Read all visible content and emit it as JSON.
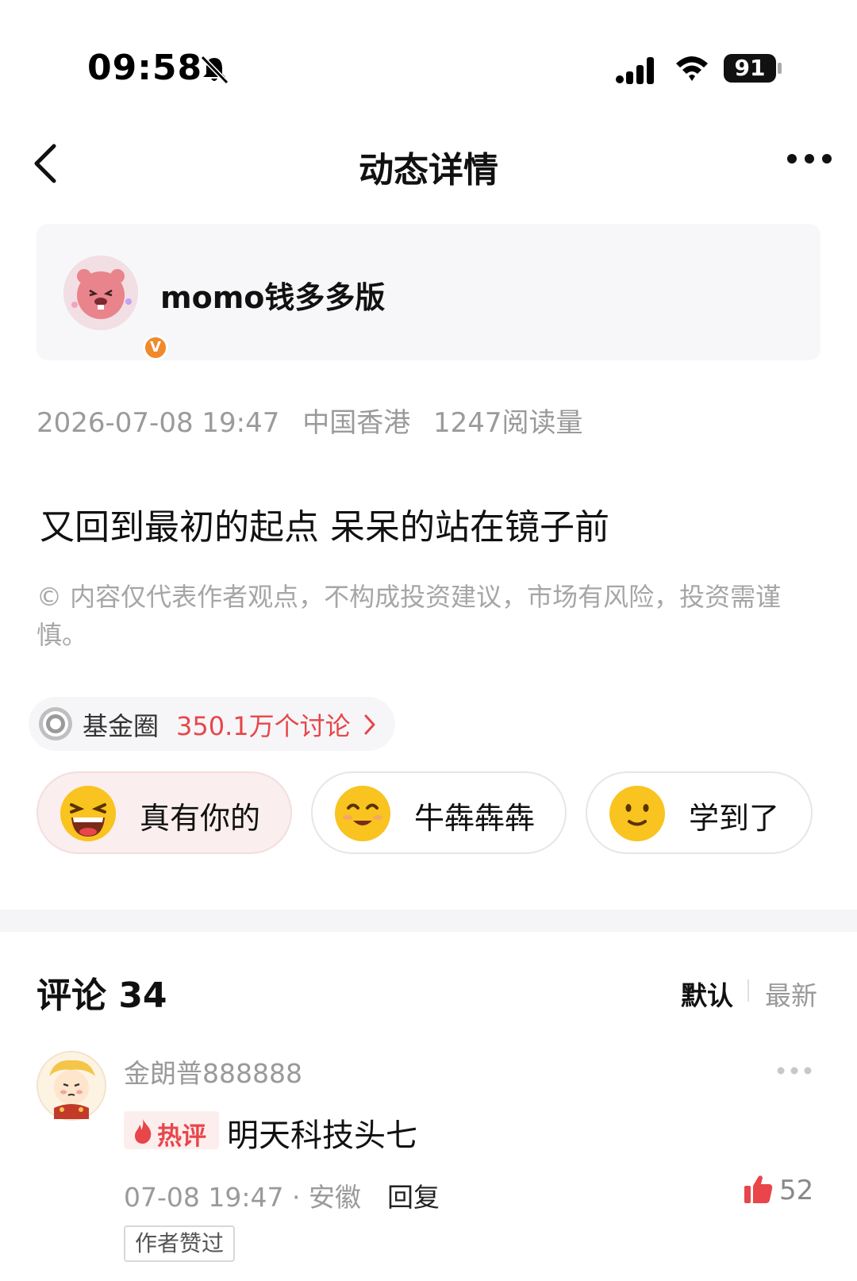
{
  "status_bar": {
    "time": "09:58",
    "battery": "91",
    "icons": [
      "bell-off-icon",
      "signal-icon",
      "wifi-icon",
      "battery-icon"
    ]
  },
  "nav": {
    "title": "动态详情",
    "icons": [
      "back-chevron-icon",
      "more-dots-icon"
    ]
  },
  "author": {
    "name": "momo钱多多版",
    "badge": "V"
  },
  "post": {
    "datetime": "2026-07-08 19:47",
    "location": "中国香港",
    "reads": "1247阅读量",
    "title": "又回到最初的起点 呆呆的站在镜子前",
    "disclaimer": "© 内容仅代表作者观点，不构成投资建议，市场有风险，投资需谨慎。"
  },
  "topic": {
    "name": "基金圈",
    "count": "350.1万个讨论"
  },
  "reactions": [
    {
      "label": "真有你的",
      "icon": "laughing-emoji-icon",
      "active": true
    },
    {
      "label": "牛犇犇犇",
      "icon": "smiling-emoji-icon",
      "active": false
    },
    {
      "label": "学到了",
      "icon": "slight-smile-emoji-icon",
      "active": false
    }
  ],
  "comments": {
    "title": "评论 34",
    "sort_default": "默认",
    "sort_latest": "最新",
    "items": [
      {
        "user": "金朗普888888",
        "badge": "热评",
        "text": "明天科技头七",
        "meta": "07-08 19:47 · 安徽",
        "reply": "回复",
        "likes": "52",
        "author_liked": "作者赞过"
      }
    ]
  },
  "colors": {
    "accent_red": "#e8464a",
    "muted_text": "#9a9a9a",
    "card_bg": "#f7f7f9",
    "verified_orange": "#f08a2c"
  }
}
